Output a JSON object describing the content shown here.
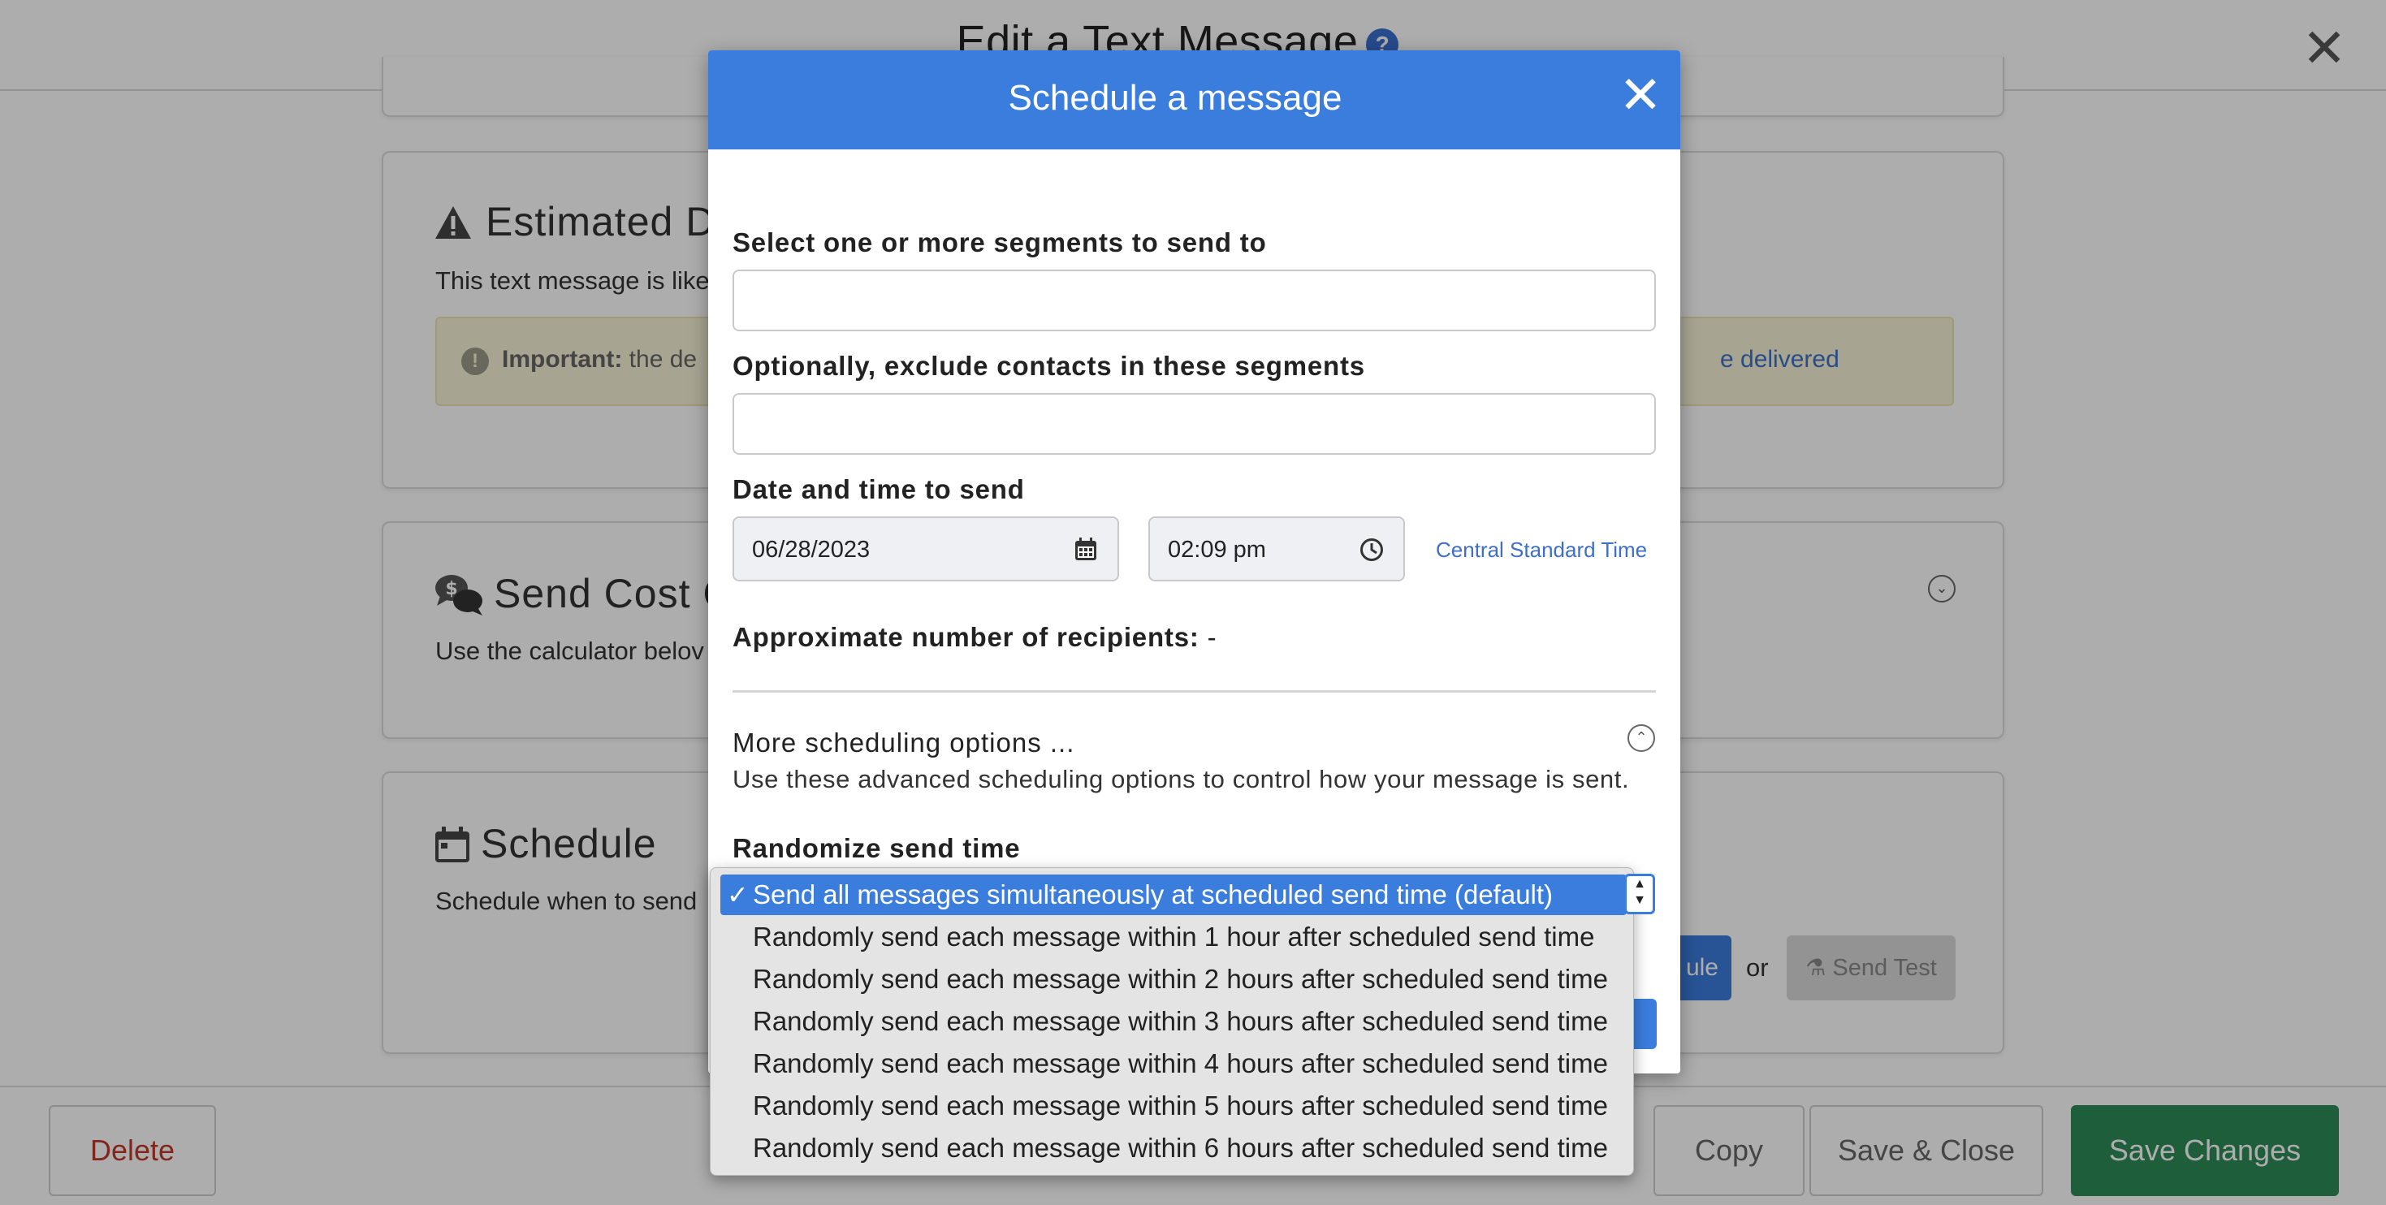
{
  "page": {
    "title": "Edit a Text Message",
    "help_glyph": "?",
    "close_glyph": "✕"
  },
  "estimated_card": {
    "title": "Estimated D",
    "text": "This text message is like",
    "alert_strong": "Important:",
    "alert_text": "the de",
    "alert_link": "e delivered"
  },
  "cost_card": {
    "title": "Send Cost C",
    "text": "Use the calculator belov"
  },
  "schedule_card": {
    "title": "Schedule",
    "text": "Schedule when to send",
    "schedule_btn": "ule",
    "or_text": "or",
    "send_test_btn": "Send Test"
  },
  "footer": {
    "delete": "Delete",
    "copy": "Copy",
    "save_close": "Save & Close",
    "save_changes": "Save Changes"
  },
  "modal": {
    "title": "Schedule a message",
    "close_glyph": "✕",
    "segments_label": "Select one or more segments to send to",
    "segments_value": "",
    "exclude_label": "Optionally, exclude contacts in these segments",
    "exclude_value": "",
    "datetime_label": "Date and time to send",
    "date_value": "06/28/2023",
    "time_value": "02:09 pm",
    "timezone": "Central Standard Time",
    "recipients_label": "Approximate number of recipients:",
    "recipients_value": "-",
    "more_options_title": "More scheduling options ...",
    "more_options_desc": "Use these advanced scheduling options to control how your message is sent.",
    "randomize_label": "Randomize send time"
  },
  "randomize_dropdown": {
    "selected_index": 0,
    "options": [
      "Send all messages simultaneously at scheduled send time (default)",
      "Randomly send each message within 1 hour after scheduled send time",
      "Randomly send each message within 2 hours after scheduled send time",
      "Randomly send each message within 3 hours after scheduled send time",
      "Randomly send each message within 4 hours after scheduled send time",
      "Randomly send each message within 5 hours after scheduled send time",
      "Randomly send each message within 6 hours after scheduled send time"
    ]
  },
  "colors": {
    "primary": "#3b7ddd",
    "success": "#2e8b57",
    "danger": "#c0392b",
    "link": "#3d6fc9",
    "alert_bg": "#f7f3d6"
  },
  "icons": {
    "warning": "warning-icon",
    "cost": "chat-dollar-icon",
    "calendar": "calendar-icon",
    "clock": "clock-icon",
    "flask": "flask-icon",
    "check": "checkmark-icon"
  }
}
